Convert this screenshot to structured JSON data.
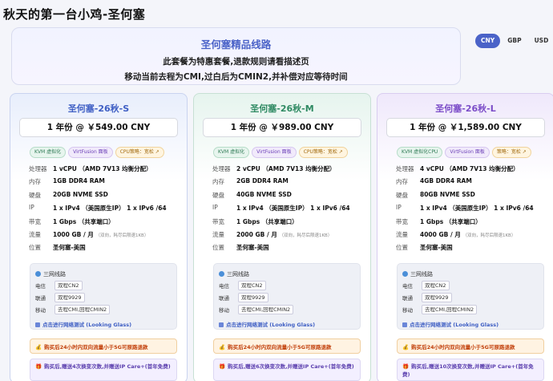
{
  "page_title": "秋天的第一台小鸡-圣何塞",
  "banner": {
    "title": "圣何塞精品线路",
    "line1": "此套餐为特惠套餐,退款规则请看描述页",
    "line2": "移动当前去程为CMI,过白后为CMIN2,并补偿对应等待时间"
  },
  "currency": {
    "options": [
      "CNY",
      "GBP",
      "USD"
    ],
    "selected": "CNY"
  },
  "plans": [
    {
      "name": "圣何塞-26秋-S",
      "price": "1 年份 @ ￥549.00 CNY",
      "tags": [
        "KVM 虚拟化",
        "VirtFusion 面板",
        "CPU策略：宽松 ↗"
      ],
      "specs": [
        {
          "k": "处理器",
          "v": "1 vCPU （AMD 7V13 均衡分配）",
          "sub": ""
        },
        {
          "k": "内存",
          "v": "1GB DDR4 RAM",
          "sub": ""
        },
        {
          "k": "硬盘",
          "v": "20GB NVME SSD",
          "sub": ""
        },
        {
          "k": "IP",
          "v": "1 x IPv4 （美国原生IP） 1 x IPv6 /64",
          "sub": ""
        },
        {
          "k": "带宽",
          "v": "1 Gbps （共享端口）",
          "sub": ""
        },
        {
          "k": "流量",
          "v": "1000 GB / 月",
          "sub": "（双向，耗尽后限速1KB）"
        },
        {
          "k": "位置",
          "v": "圣何塞-美国",
          "sub": ""
        }
      ]
    },
    {
      "name": "圣何塞-26秋-M",
      "price": "1 年份 @ ￥989.00 CNY",
      "tags": [
        "KVM 虚拟化",
        "VirtFusion 面板",
        "CPU策略：宽松 ↗"
      ],
      "specs": [
        {
          "k": "处理器",
          "v": "2 vCPU （AMD 7V13 均衡分配）",
          "sub": ""
        },
        {
          "k": "内存",
          "v": "2GB DDR4 RAM",
          "sub": ""
        },
        {
          "k": "硬盘",
          "v": "40GB NVME SSD",
          "sub": ""
        },
        {
          "k": "IP",
          "v": "1 x IPv4 （美国原生IP） 1 x IPv6 /64",
          "sub": ""
        },
        {
          "k": "带宽",
          "v": "1 Gbps （共享端口）",
          "sub": ""
        },
        {
          "k": "流量",
          "v": "2000 GB / 月",
          "sub": "（双向，耗尽后限速1KB）"
        },
        {
          "k": "位置",
          "v": "圣何塞-美国",
          "sub": ""
        }
      ]
    },
    {
      "name": "圣何塞-26秋-L",
      "price": "1 年份 @ ￥1,589.00 CNY",
      "tags": [
        "KVM 虚拟化CPU",
        "VirtFusion 面板",
        "策略：宽松 ↗"
      ],
      "specs": [
        {
          "k": "处理器",
          "v": "4 vCPU （AMD 7V13 均衡分配）",
          "sub": ""
        },
        {
          "k": "内存",
          "v": "4GB DDR4 RAM",
          "sub": ""
        },
        {
          "k": "硬盘",
          "v": "80GB NVME SSD",
          "sub": ""
        },
        {
          "k": "IP",
          "v": "1 x IPv4 （美国原生IP） 1 x IPv6 /64",
          "sub": ""
        },
        {
          "k": "带宽",
          "v": "1 Gbps （共享端口）",
          "sub": ""
        },
        {
          "k": "流量",
          "v": "4000 GB / 月",
          "sub": "（双向，耗尽后限速1KB）"
        },
        {
          "k": "位置",
          "v": "圣何塞-美国",
          "sub": ""
        }
      ]
    }
  ],
  "routes": {
    "title": "三网线路",
    "rows": [
      {
        "k": "电信",
        "v": "双程CN2"
      },
      {
        "k": "联通",
        "v": "双程9929"
      },
      {
        "k": "移动",
        "v": "去程CMI,回程CMIN2"
      }
    ],
    "looking_glass": "点击进行网络测试 (Looking Glass)"
  },
  "notice": "购买后24小时内双向流量小于5G可原路退款",
  "gifts": [
    "购买后,赠送4次换变次数,并赠送IP Care+(首年免费)",
    "购买后,赠送6次换变次数,并赠送IP Care+(首年免费)",
    "购买后,赠送10次换变次数,并赠送IP Care+(首年免费)"
  ]
}
